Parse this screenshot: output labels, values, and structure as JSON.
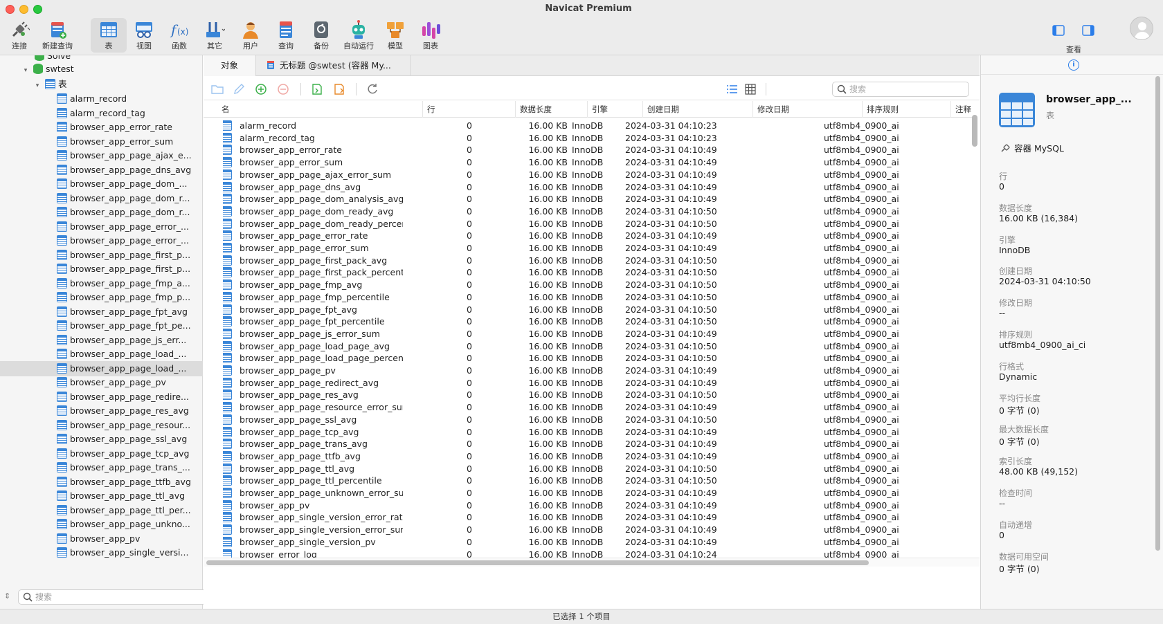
{
  "window": {
    "title": "Navicat Premium"
  },
  "toolbar": {
    "items": [
      {
        "label": "连接",
        "icon": "connection-plug-icon"
      },
      {
        "label": "新建查询",
        "icon": "new-query-icon"
      },
      {
        "label": "表",
        "icon": "table-icon",
        "active": true
      },
      {
        "label": "视图",
        "icon": "view-glasses-icon"
      },
      {
        "label": "函数",
        "icon": "function-fx-icon"
      },
      {
        "label": "其它",
        "icon": "tools-icon"
      },
      {
        "label": "用户",
        "icon": "user-icon"
      },
      {
        "label": "查询",
        "icon": "query-icon"
      },
      {
        "label": "备份",
        "icon": "backup-icon"
      },
      {
        "label": "自动运行",
        "icon": "robot-icon"
      },
      {
        "label": "模型",
        "icon": "model-icon"
      },
      {
        "label": "图表",
        "icon": "chart-icon"
      }
    ],
    "view_label": "查看"
  },
  "sidebar": {
    "partial_top": "Solve",
    "database": "swtest",
    "folder": "表",
    "tables": [
      "alarm_record",
      "alarm_record_tag",
      "browser_app_error_rate",
      "browser_app_error_sum",
      "browser_app_page_ajax_e...",
      "browser_app_page_dns_avg",
      "browser_app_page_dom_...",
      "browser_app_page_dom_r...",
      "browser_app_page_dom_r...",
      "browser_app_page_error_...",
      "browser_app_page_error_...",
      "browser_app_page_first_p...",
      "browser_app_page_first_p...",
      "browser_app_page_fmp_a...",
      "browser_app_page_fmp_p...",
      "browser_app_page_fpt_avg",
      "browser_app_page_fpt_pe...",
      "browser_app_page_js_err...",
      "browser_app_page_load_...",
      "browser_app_page_load_...",
      "browser_app_page_pv",
      "browser_app_page_redire...",
      "browser_app_page_res_avg",
      "browser_app_page_resour...",
      "browser_app_page_ssl_avg",
      "browser_app_page_tcp_avg",
      "browser_app_page_trans_...",
      "browser_app_page_ttfb_avg",
      "browser_app_page_ttl_avg",
      "browser_app_page_ttl_per...",
      "browser_app_page_unkno...",
      "browser_app_pv",
      "browser_app_single_versi..."
    ],
    "selected_index": 19,
    "search_placeholder": "搜索"
  },
  "tabs": [
    {
      "label": "对象",
      "active": true
    },
    {
      "label": "无标题 @swtest (容器 My..."
    }
  ],
  "objects": {
    "search_placeholder": "搜索",
    "columns": [
      "名",
      "行",
      "数据长度",
      "引擎",
      "创建日期",
      "修改日期",
      "排序规则",
      "注释"
    ],
    "rows": [
      [
        "alarm_record",
        "0",
        "16.00 KB",
        "InnoDB",
        "2024-03-31 04:10:23",
        "",
        "utf8mb4_0900_ai..."
      ],
      [
        "alarm_record_tag",
        "0",
        "16.00 KB",
        "InnoDB",
        "2024-03-31 04:10:23",
        "",
        "utf8mb4_0900_ai..."
      ],
      [
        "browser_app_error_rate",
        "0",
        "16.00 KB",
        "InnoDB",
        "2024-03-31 04:10:49",
        "",
        "utf8mb4_0900_ai..."
      ],
      [
        "browser_app_error_sum",
        "0",
        "16.00 KB",
        "InnoDB",
        "2024-03-31 04:10:49",
        "",
        "utf8mb4_0900_ai..."
      ],
      [
        "browser_app_page_ajax_error_sum",
        "0",
        "16.00 KB",
        "InnoDB",
        "2024-03-31 04:10:49",
        "",
        "utf8mb4_0900_ai..."
      ],
      [
        "browser_app_page_dns_avg",
        "0",
        "16.00 KB",
        "InnoDB",
        "2024-03-31 04:10:49",
        "",
        "utf8mb4_0900_ai..."
      ],
      [
        "browser_app_page_dom_analysis_avg",
        "0",
        "16.00 KB",
        "InnoDB",
        "2024-03-31 04:10:49",
        "",
        "utf8mb4_0900_ai..."
      ],
      [
        "browser_app_page_dom_ready_avg",
        "0",
        "16.00 KB",
        "InnoDB",
        "2024-03-31 04:10:50",
        "",
        "utf8mb4_0900_ai..."
      ],
      [
        "browser_app_page_dom_ready_percentile",
        "0",
        "16.00 KB",
        "InnoDB",
        "2024-03-31 04:10:50",
        "",
        "utf8mb4_0900_ai..."
      ],
      [
        "browser_app_page_error_rate",
        "0",
        "16.00 KB",
        "InnoDB",
        "2024-03-31 04:10:49",
        "",
        "utf8mb4_0900_ai..."
      ],
      [
        "browser_app_page_error_sum",
        "0",
        "16.00 KB",
        "InnoDB",
        "2024-03-31 04:10:49",
        "",
        "utf8mb4_0900_ai..."
      ],
      [
        "browser_app_page_first_pack_avg",
        "0",
        "16.00 KB",
        "InnoDB",
        "2024-03-31 04:10:50",
        "",
        "utf8mb4_0900_ai..."
      ],
      [
        "browser_app_page_first_pack_percentile",
        "0",
        "16.00 KB",
        "InnoDB",
        "2024-03-31 04:10:50",
        "",
        "utf8mb4_0900_ai..."
      ],
      [
        "browser_app_page_fmp_avg",
        "0",
        "16.00 KB",
        "InnoDB",
        "2024-03-31 04:10:50",
        "",
        "utf8mb4_0900_ai..."
      ],
      [
        "browser_app_page_fmp_percentile",
        "0",
        "16.00 KB",
        "InnoDB",
        "2024-03-31 04:10:50",
        "",
        "utf8mb4_0900_ai..."
      ],
      [
        "browser_app_page_fpt_avg",
        "0",
        "16.00 KB",
        "InnoDB",
        "2024-03-31 04:10:50",
        "",
        "utf8mb4_0900_ai..."
      ],
      [
        "browser_app_page_fpt_percentile",
        "0",
        "16.00 KB",
        "InnoDB",
        "2024-03-31 04:10:50",
        "",
        "utf8mb4_0900_ai..."
      ],
      [
        "browser_app_page_js_error_sum",
        "0",
        "16.00 KB",
        "InnoDB",
        "2024-03-31 04:10:49",
        "",
        "utf8mb4_0900_ai..."
      ],
      [
        "browser_app_page_load_page_avg",
        "0",
        "16.00 KB",
        "InnoDB",
        "2024-03-31 04:10:50",
        "",
        "utf8mb4_0900_ai..."
      ],
      [
        "browser_app_page_load_page_percentile",
        "0",
        "16.00 KB",
        "InnoDB",
        "2024-03-31 04:10:50",
        "",
        "utf8mb4_0900_ai..."
      ],
      [
        "browser_app_page_pv",
        "0",
        "16.00 KB",
        "InnoDB",
        "2024-03-31 04:10:49",
        "",
        "utf8mb4_0900_ai..."
      ],
      [
        "browser_app_page_redirect_avg",
        "0",
        "16.00 KB",
        "InnoDB",
        "2024-03-31 04:10:49",
        "",
        "utf8mb4_0900_ai..."
      ],
      [
        "browser_app_page_res_avg",
        "0",
        "16.00 KB",
        "InnoDB",
        "2024-03-31 04:10:50",
        "",
        "utf8mb4_0900_ai..."
      ],
      [
        "browser_app_page_resource_error_sum",
        "0",
        "16.00 KB",
        "InnoDB",
        "2024-03-31 04:10:49",
        "",
        "utf8mb4_0900_ai..."
      ],
      [
        "browser_app_page_ssl_avg",
        "0",
        "16.00 KB",
        "InnoDB",
        "2024-03-31 04:10:50",
        "",
        "utf8mb4_0900_ai..."
      ],
      [
        "browser_app_page_tcp_avg",
        "0",
        "16.00 KB",
        "InnoDB",
        "2024-03-31 04:10:49",
        "",
        "utf8mb4_0900_ai..."
      ],
      [
        "browser_app_page_trans_avg",
        "0",
        "16.00 KB",
        "InnoDB",
        "2024-03-31 04:10:49",
        "",
        "utf8mb4_0900_ai..."
      ],
      [
        "browser_app_page_ttfb_avg",
        "0",
        "16.00 KB",
        "InnoDB",
        "2024-03-31 04:10:49",
        "",
        "utf8mb4_0900_ai..."
      ],
      [
        "browser_app_page_ttl_avg",
        "0",
        "16.00 KB",
        "InnoDB",
        "2024-03-31 04:10:50",
        "",
        "utf8mb4_0900_ai..."
      ],
      [
        "browser_app_page_ttl_percentile",
        "0",
        "16.00 KB",
        "InnoDB",
        "2024-03-31 04:10:50",
        "",
        "utf8mb4_0900_ai..."
      ],
      [
        "browser_app_page_unknown_error_sum",
        "0",
        "16.00 KB",
        "InnoDB",
        "2024-03-31 04:10:49",
        "",
        "utf8mb4_0900_ai..."
      ],
      [
        "browser_app_pv",
        "0",
        "16.00 KB",
        "InnoDB",
        "2024-03-31 04:10:49",
        "",
        "utf8mb4_0900_ai..."
      ],
      [
        "browser_app_single_version_error_rate",
        "0",
        "16.00 KB",
        "InnoDB",
        "2024-03-31 04:10:49",
        "",
        "utf8mb4_0900_ai..."
      ],
      [
        "browser_app_single_version_error_sum",
        "0",
        "16.00 KB",
        "InnoDB",
        "2024-03-31 04:10:49",
        "",
        "utf8mb4_0900_ai..."
      ],
      [
        "browser_app_single_version_pv",
        "0",
        "16.00 KB",
        "InnoDB",
        "2024-03-31 04:10:49",
        "",
        "utf8mb4_0900_ai..."
      ],
      [
        "browser_error_log",
        "0",
        "16.00 KB",
        "InnoDB",
        "2024-03-31 04:10:24",
        "",
        "utf8mb4_0900_ai..."
      ]
    ]
  },
  "info": {
    "name": "browser_app_...",
    "type": "表",
    "connection": "容器 MySQL",
    "props": [
      {
        "label": "行",
        "value": "0"
      },
      {
        "label": "数据长度",
        "value": "16.00 KB (16,384)"
      },
      {
        "label": "引擎",
        "value": "InnoDB"
      },
      {
        "label": "创建日期",
        "value": "2024-03-31 04:10:50"
      },
      {
        "label": "修改日期",
        "value": "--"
      },
      {
        "label": "排序规则",
        "value": "utf8mb4_0900_ai_ci"
      },
      {
        "label": "行格式",
        "value": "Dynamic"
      },
      {
        "label": "平均行长度",
        "value": "0 字节 (0)"
      },
      {
        "label": "最大数据长度",
        "value": "0 字节 (0)"
      },
      {
        "label": "索引长度",
        "value": "48.00 KB (49,152)"
      },
      {
        "label": "检查时间",
        "value": "--"
      },
      {
        "label": "自动递增",
        "value": "0"
      },
      {
        "label": "数据可用空间",
        "value": "0 字节 (0)"
      }
    ]
  },
  "status": {
    "text": "已选择 1 个项目"
  },
  "colors": {
    "accent": "#2b7de9",
    "table_icon": "#3a86d8",
    "db_icon": "#3cb04a"
  }
}
